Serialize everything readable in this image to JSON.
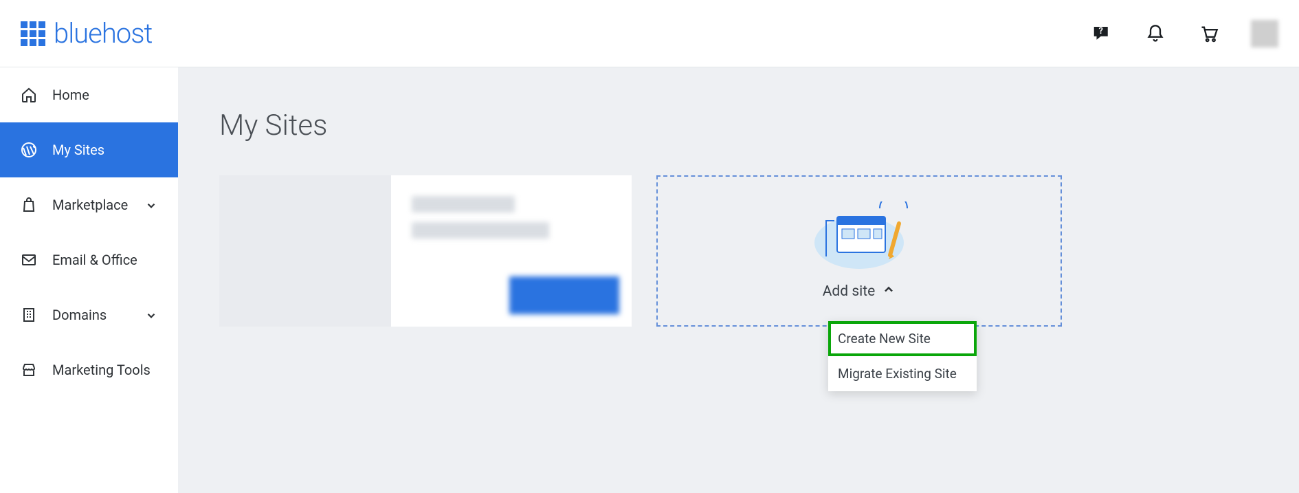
{
  "header": {
    "brand": "bluehost"
  },
  "sidebar": {
    "items": [
      {
        "label": "Home"
      },
      {
        "label": "My Sites"
      },
      {
        "label": "Marketplace"
      },
      {
        "label": "Email & Office"
      },
      {
        "label": "Domains"
      },
      {
        "label": "Marketing Tools"
      }
    ]
  },
  "page": {
    "title": "My Sites"
  },
  "add_site": {
    "label": "Add site",
    "dropdown": {
      "create": "Create New Site",
      "migrate": "Migrate Existing Site"
    }
  }
}
